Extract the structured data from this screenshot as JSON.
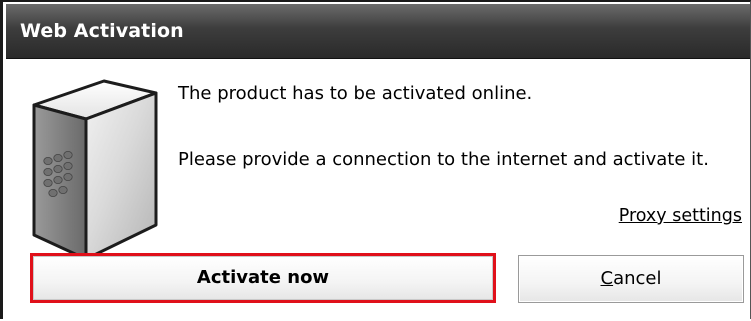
{
  "window": {
    "title": "Web Activation"
  },
  "content": {
    "icon": "product-box-icon",
    "message_line1": "The product has to be activated online.",
    "message_line2": "Please provide a connection to the internet and activate it.",
    "proxy_link": "Proxy settings"
  },
  "buttons": {
    "activate_label": "Activate now",
    "cancel_accel": "C",
    "cancel_rest": "ancel"
  },
  "colors": {
    "highlight": "#e0101a",
    "titlebar": "#3d3d3d"
  }
}
